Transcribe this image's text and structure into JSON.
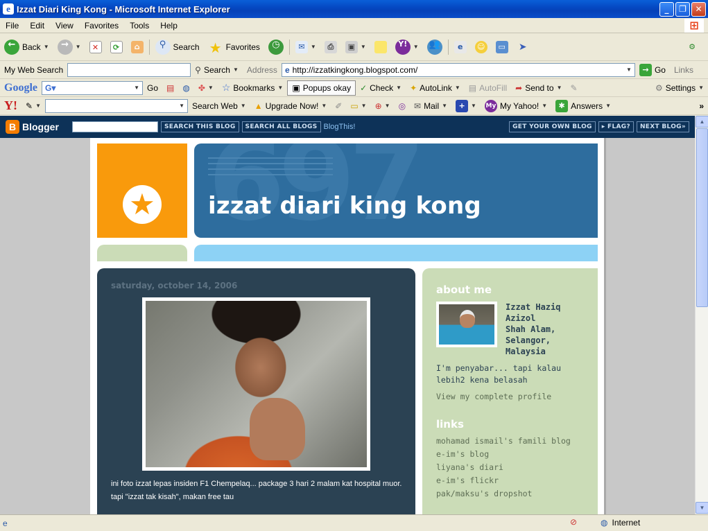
{
  "window": {
    "title": "Izzat Diari King Kong - Microsoft Internet Explorer",
    "min": "_",
    "max": "❐",
    "close": "✕"
  },
  "menu": [
    "File",
    "Edit",
    "View",
    "Favorites",
    "Tools",
    "Help"
  ],
  "toolbar": {
    "back": "Back",
    "search": "Search",
    "favorites": "Favorites"
  },
  "addressbar": {
    "my_web_search": "My Web Search",
    "search_btn": "Search",
    "address_label": "Address",
    "url": "http://izzatkingkong.blogspot.com/",
    "go": "Go",
    "links": "Links"
  },
  "google_toolbar": {
    "logo": "Google",
    "go": "Go",
    "bookmarks": "Bookmarks",
    "popups": "Popups okay",
    "check": "Check",
    "autolink": "AutoLink",
    "autofill": "AutoFill",
    "send_to": "Send to",
    "settings": "Settings"
  },
  "yahoo_toolbar": {
    "logo": "Y!",
    "search_web": "Search Web",
    "upgrade": "Upgrade Now!",
    "mail": "Mail",
    "my_yahoo": "My Yahoo!",
    "answers": "Answers"
  },
  "blogger_nav": {
    "logo": "Blogger",
    "search_this": "SEARCH THIS BLOG",
    "search_all": "SEARCH ALL BLOGS",
    "blogthis": "BlogThis!",
    "get_own": "GET YOUR OWN BLOG",
    "flag": "▸ FLAG?",
    "next": "NEXT BLOG»"
  },
  "blog": {
    "title": "izzat diari king kong",
    "post_date": "saturday, october 14, 2006",
    "post_text": "ini foto izzat lepas insiden F1 Chempelaq... package 3 hari 2 malam kat hospital muor. tapi \"izzat tak kisah\", makan free tau"
  },
  "sidebar": {
    "about_heading": "about me",
    "name_line1": "Izzat Haziq",
    "name_line2": "Azizol",
    "location_line1": "Shah Alam,",
    "location_line2": "Selangor,",
    "location_line3": "Malaysia",
    "bio": "I'm penyabar... tapi kalau lebih2 kena belasah",
    "profile_link": "View my complete profile",
    "links_heading": "links",
    "links": [
      "mohamad ismail's famili blog",
      "e-im's blog",
      "liyana's diari",
      "e-im's flickr",
      "pak/maksu's dropshot"
    ]
  },
  "status": {
    "zone": "Internet"
  }
}
